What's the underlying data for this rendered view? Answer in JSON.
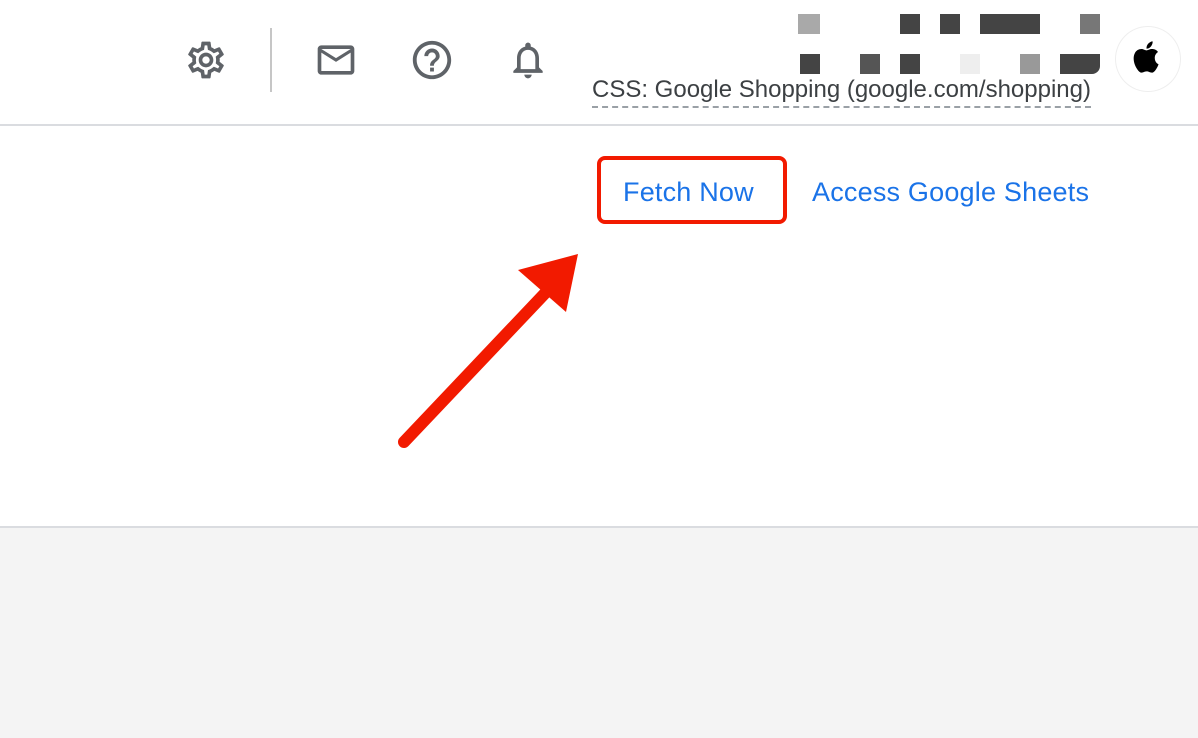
{
  "header": {
    "settings_icon": "gear-icon",
    "mail_icon": "mail-icon",
    "help_icon": "help-circle-icon",
    "notifications_icon": "bell-icon",
    "account_label": "CSS: Google Shopping (google.com/shopping)",
    "avatar_icon": "apple-logo-icon"
  },
  "actions": {
    "fetch_now_label": "Fetch Now",
    "access_sheets_label": "Access Google Sheets"
  },
  "annotation": {
    "arrow_color": "#f21a00",
    "highlight_color": "#f21a00"
  },
  "colors": {
    "link": "#1a73e8",
    "icon": "#5f6368",
    "footer_bg": "#f4f4f4"
  }
}
